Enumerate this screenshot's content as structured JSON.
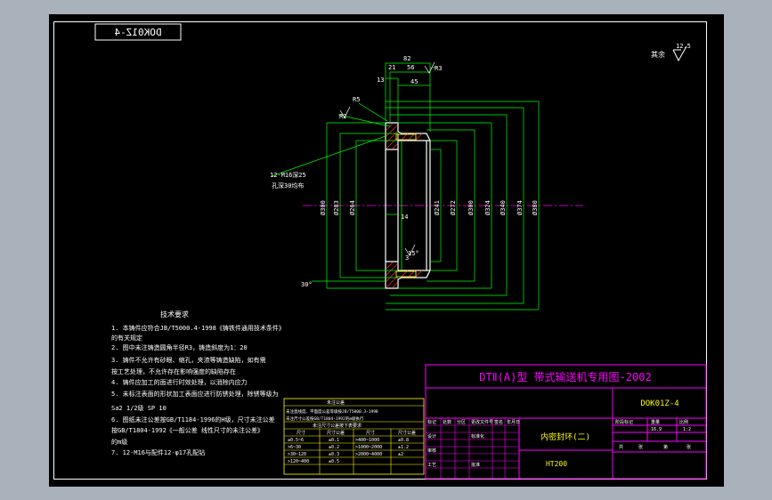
{
  "drawing": {
    "code_box": "DOK01Z-4",
    "code_box_mirrored": true,
    "roughness_note": "其余",
    "roughness_value": "12.5"
  },
  "part_dims": {
    "d82": "82",
    "d21": "21",
    "d56": "56",
    "d13": "13",
    "d45": "45",
    "d14": "14",
    "d3": "3",
    "chamfer": "R5",
    "ra_a": "R3",
    "ra_b": "R2",
    "angle_a": "15°",
    "angle_b": "30°",
    "thread_note": "12-M16深25",
    "thread_sub": "孔深30均布",
    "dia": [
      "Ø300",
      "Ø283",
      "Ø264",
      "Ø241",
      "Ø272",
      "Ø300",
      "Ø324",
      "Ø340",
      "Ø374",
      "Ø380"
    ]
  },
  "tech": {
    "title": "技术要求",
    "items": [
      "1. 本铸件应符合JB/T5000.4-1998《铸铁件通用技术条件》",
      "   的有关规定",
      "2. 图中未注铸造圆角半径R3，铸造斜度为1：20",
      "3. 铸件不允许有砂眼、缩孔，夹渣等铸造缺陷，如有需",
      "   按工艺处理，不允许存在影响强度的缺陷存在",
      "4. 铸件应加工的面进行时效处理，以消除内应力",
      "5. 未标注表面的形状加工表面应进行防锈处理，除锈等级为",
      "   Sa2 1/2级 SP 10",
      "6. 图纸未注公差按GB/T1184-1996的H级，尺寸未注公差",
      "   按GB/T1804-1992《一般公差 线性尺寸的未注公差》",
      "   的m级",
      "7. 12-M16与配件12-φ17孔配钻"
    ]
  },
  "tol_table": {
    "title": "未注公差",
    "note1": "未注直线度、平面度公差等级按JB/T5000.3-1998",
    "note2": "未注尺寸公差按GB/T1804-1992的m级执行",
    "sub": "未注尺寸公差按下表要求",
    "head": [
      "尺寸",
      "尺寸公差",
      "尺寸",
      "尺寸公差"
    ],
    "rows": [
      [
        "≥0.5~6",
        "±0.1",
        ">400~1000",
        "±0.8"
      ],
      [
        ">6~30",
        "±0.2",
        ">1000~2000",
        "±1.2"
      ],
      [
        ">30~120",
        "±0.3",
        ">2000~4000",
        "±2"
      ],
      [
        ">120~400",
        "±0.5",
        "",
        ""
      ]
    ]
  },
  "title_block": {
    "header": "DTⅡ(A)型 带式输送机专用图-2002",
    "drawing_no": "DOK01Z-4",
    "part_name": "内密封环(二)",
    "material": "HT200",
    "labels": [
      "标记",
      "处数",
      "分区",
      "更改文件号",
      "签名",
      "年月日",
      "设计",
      "标准化",
      "审核",
      "工艺",
      "批准",
      "阶段标记",
      "重量",
      "比例",
      "共",
      "张",
      "第",
      "张"
    ],
    "weight": "16.9",
    "scale": "1:2"
  }
}
